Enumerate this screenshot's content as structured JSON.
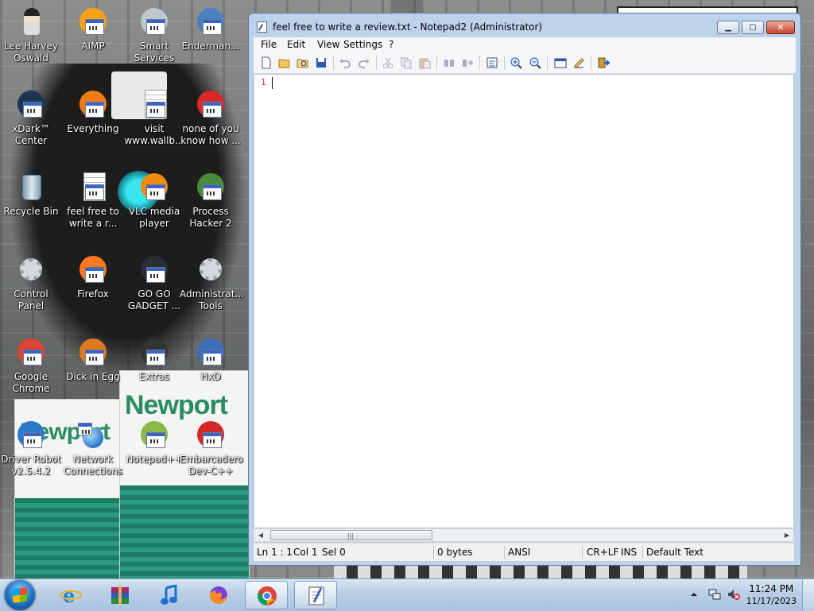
{
  "desktop": {
    "icons": [
      {
        "label": "Lee Harvey\nOswald",
        "icon": "character-icon"
      },
      {
        "label": "AIMP",
        "icon": "aimp-icon"
      },
      {
        "label": "Smart\nServices",
        "icon": "services-gear-icon"
      },
      {
        "label": "Enderman...",
        "icon": "app-icon"
      },
      {
        "label": "xDark™\nCenter",
        "icon": "xdark-icon"
      },
      {
        "label": "Everything",
        "icon": "everything-icon"
      },
      {
        "label": "visit\nwww.wallb...",
        "icon": "text-file-icon"
      },
      {
        "label": "none of you\nknow how ...",
        "icon": "shortcut-icon"
      },
      {
        "label": "Recycle Bin",
        "icon": "recycle-bin-icon"
      },
      {
        "label": "feel free to\nwrite a r...",
        "icon": "text-file-icon"
      },
      {
        "label": "VLC media\nplayer",
        "icon": "vlc-icon"
      },
      {
        "label": "Process\nHacker 2",
        "icon": "process-hacker-icon"
      },
      {
        "label": "Control Panel",
        "icon": "control-panel-icon"
      },
      {
        "label": "Firefox",
        "icon": "firefox-icon"
      },
      {
        "label": "GO GO\nGADGET ...",
        "icon": "gadget-icon"
      },
      {
        "label": "Administrat...\nTools",
        "icon": "admin-tools-icon"
      },
      {
        "label": "Google\nChrome",
        "icon": "chrome-icon"
      },
      {
        "label": "Dick in Egg",
        "icon": "egg-app-icon"
      },
      {
        "label": "Extras",
        "icon": "extras-icon"
      },
      {
        "label": "HxD",
        "icon": "hxd-icon"
      },
      {
        "label": "Driver Robot\nv2.5.4.2",
        "icon": "driver-robot-icon"
      },
      {
        "label": "Network\nConnections",
        "icon": "network-icon"
      },
      {
        "label": "Notepad++",
        "icon": "notepadpp-icon"
      },
      {
        "label": "Embarcadero\nDev-C++",
        "icon": "devcpp-icon"
      }
    ],
    "wallpaper_brand": "Newport"
  },
  "window": {
    "title": "feel free to write a review.txt - Notepad2 (Administrator)",
    "minimize_glyph": "▁",
    "maximize_glyph": "▢",
    "close_glyph": "✕",
    "menu": [
      "File",
      "Edit",
      "View",
      "Settings",
      "?"
    ],
    "toolbar_icons": [
      "new-file-icon",
      "open-folder-icon",
      "browse-icon",
      "save-icon",
      "undo-icon",
      "redo-icon",
      "cut-icon",
      "copy-icon",
      "paste-icon",
      "find-icon",
      "replace-icon",
      "word-wrap-icon",
      "zoom-in-icon",
      "zoom-out-icon",
      "scheme-icon",
      "customize-icon",
      "exit-icon"
    ],
    "editor": {
      "line_number": "1",
      "content": ""
    },
    "scrollbar": {
      "left_arrow": "◀",
      "right_arrow": "▶",
      "grip": "|||"
    },
    "status": {
      "position": "Ln 1 : 1",
      "col": "Col 1",
      "sel": "Sel 0",
      "size": "0 bytes",
      "encoding": "ANSI",
      "line_ending": "CR+LF",
      "mode": "INS",
      "scheme": "Default Text"
    }
  },
  "taskbar": {
    "pinned": [
      "internet-explorer-icon",
      "winrar-icon",
      "music-note-icon",
      "firefox-icon",
      "chrome-icon",
      "notepad2-icon"
    ],
    "time": "11:24 PM",
    "date": "11/17/2023"
  },
  "colors": {
    "line_number": "#e03a3a",
    "window_frame": "#bcd2ea",
    "taskbar": "#b9cfe6"
  }
}
